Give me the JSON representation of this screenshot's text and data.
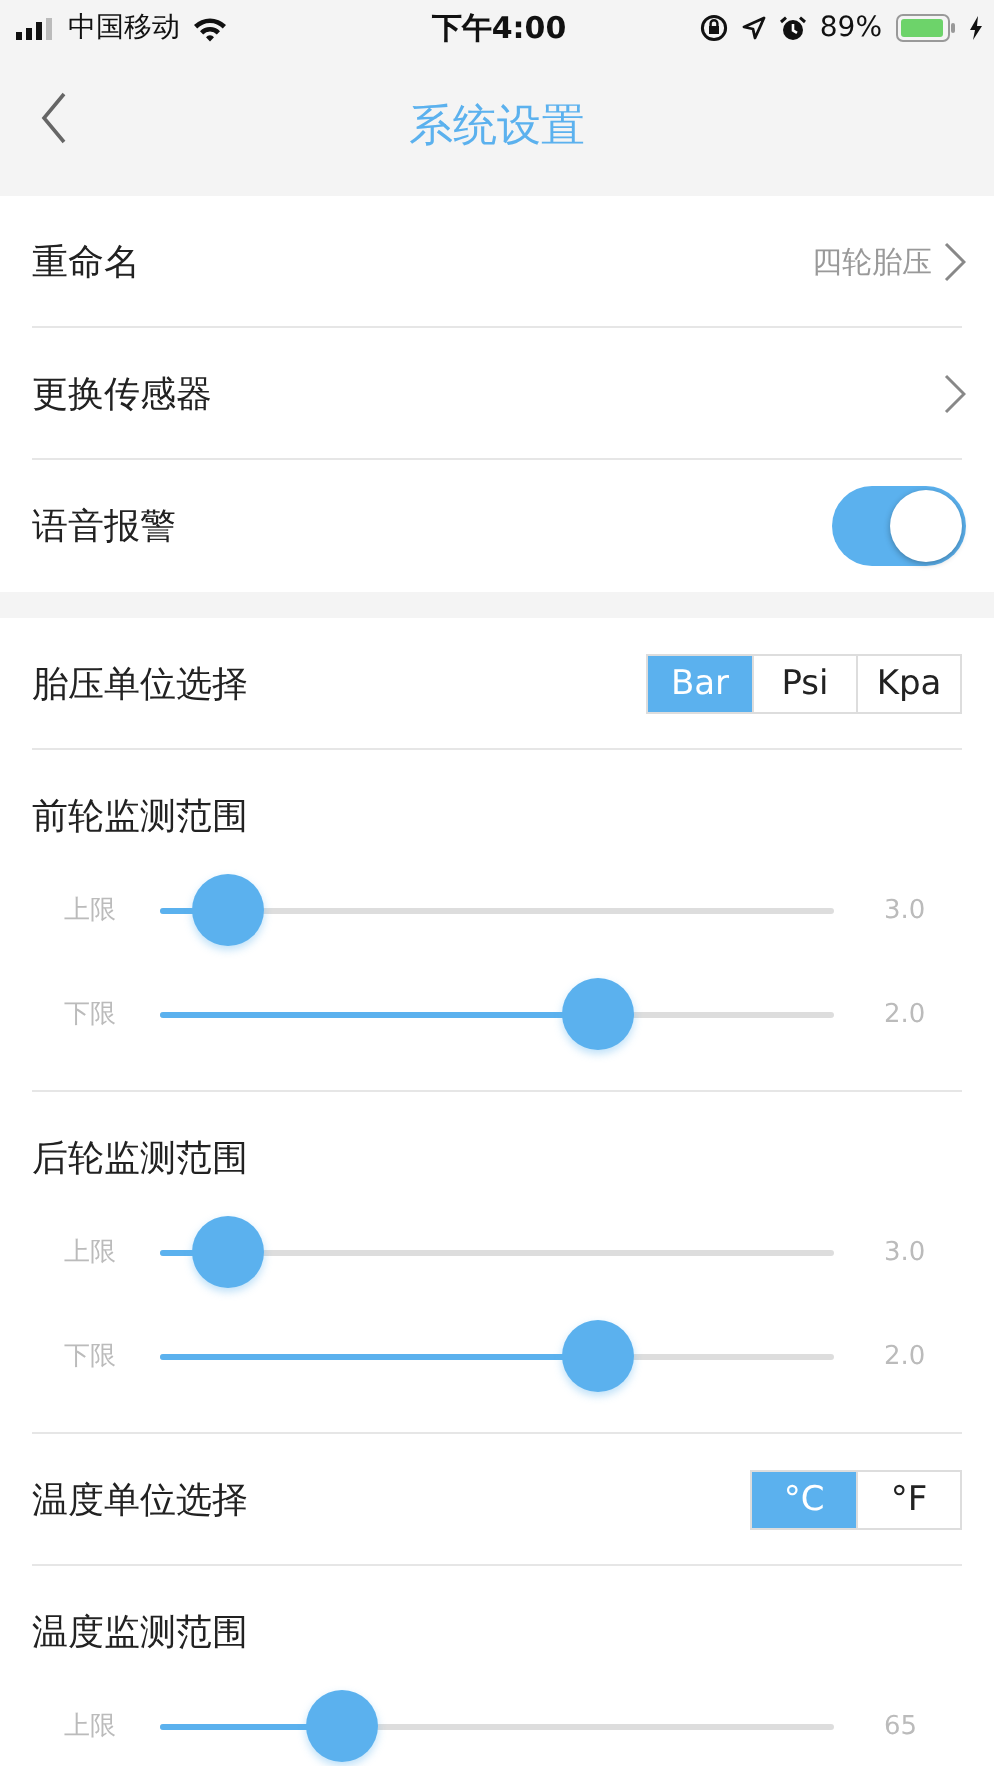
{
  "status_bar": {
    "carrier": "中国移动",
    "time": "下午4:00",
    "battery": "89%"
  },
  "nav": {
    "title": "系统设置"
  },
  "general": [
    {
      "kind": "link",
      "label": "重命名",
      "value": "四轮胎压"
    },
    {
      "kind": "link",
      "label": "更换传感器"
    },
    {
      "kind": "toggle",
      "label": "语音报警",
      "on": true
    }
  ],
  "monitoring": [
    {
      "kind": "segmented",
      "label": "胎压单位选择",
      "options": [
        {
          "label": "Bar",
          "selected": true
        },
        {
          "label": "Psi",
          "selected": false
        },
        {
          "label": "Kpa",
          "selected": false
        }
      ]
    },
    {
      "kind": "range",
      "label": "前轮监测范围",
      "sliders": [
        {
          "label": "上限",
          "level": 0.1,
          "reading": "3.0"
        },
        {
          "label": "下限",
          "level": 0.65,
          "reading": "2.0"
        }
      ]
    },
    {
      "kind": "range",
      "label": "后轮监测范围",
      "sliders": [
        {
          "label": "上限",
          "level": 0.1,
          "reading": "3.0"
        },
        {
          "label": "下限",
          "level": 0.65,
          "reading": "2.0"
        }
      ]
    },
    {
      "kind": "segmented",
      "label": "温度单位选择",
      "options": [
        {
          "label": "°C",
          "selected": true
        },
        {
          "label": "°F",
          "selected": false
        }
      ]
    },
    {
      "kind": "range",
      "label": "温度监测范围",
      "sliders": [
        {
          "label": "上限",
          "level": 0.27,
          "reading": "65"
        }
      ]
    }
  ]
}
